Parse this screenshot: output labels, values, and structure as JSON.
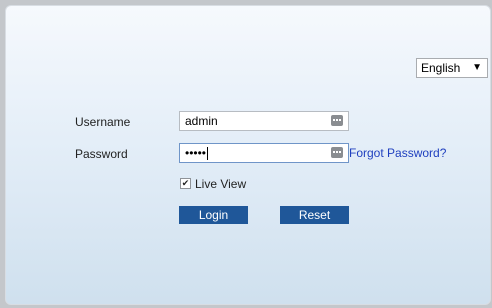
{
  "language": {
    "selected": "English",
    "chevron_icon": "chevron-down-icon"
  },
  "form": {
    "username_label": "Username",
    "username_value": "admin",
    "password_label": "Password",
    "password_value": "•••••",
    "forgot_password": "Forgot Password?",
    "live_view_label": "Live View",
    "live_view_checked": true,
    "key_icon": "keyboard-icon"
  },
  "buttons": {
    "login": "Login",
    "reset": "Reset"
  },
  "colors": {
    "button_bg": "#1f5799",
    "link": "#1f3fbf"
  }
}
